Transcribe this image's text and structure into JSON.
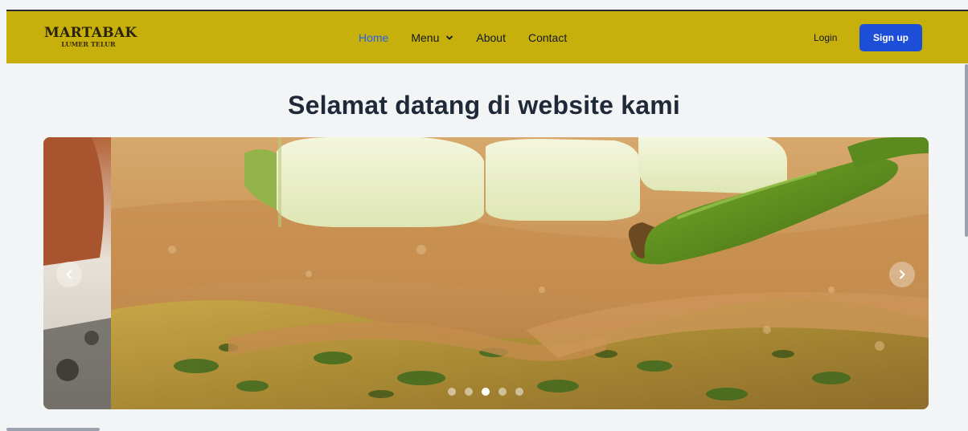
{
  "brand": {
    "name": "MARTABAK",
    "tagline": "LUMER TELUR"
  },
  "nav": {
    "items": [
      {
        "label": "Home",
        "active": true
      },
      {
        "label": "Menu",
        "has_dropdown": true
      },
      {
        "label": "About"
      },
      {
        "label": "Contact"
      }
    ],
    "login_label": "Login",
    "signup_label": "Sign up"
  },
  "hero": {
    "title": "Selamat datang di website kami"
  },
  "carousel": {
    "slide_count": 5,
    "active_index": 2
  },
  "colors": {
    "navbar_bg": "#c8b00c",
    "active_link": "#2563eb",
    "signup_bg": "#1d4ed8",
    "page_bg": "#f3f4f6",
    "title": "#1f2937"
  },
  "icons": {
    "menu_dropdown": "chevron-down-icon",
    "carousel_prev": "chevron-left-icon",
    "carousel_next": "chevron-right-icon"
  }
}
